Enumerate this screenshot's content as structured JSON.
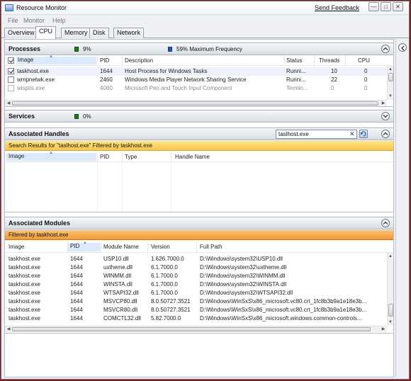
{
  "window": {
    "title": "Resource Monitor",
    "send_feedback": "Send Feedback",
    "controls": [
      "minimize-icon",
      "maximize-icon",
      "close-icon"
    ]
  },
  "menu": {
    "items": [
      "File",
      "Monitor",
      "Help"
    ]
  },
  "tabs": [
    "Overview",
    "CPU",
    "Memory",
    "Disk",
    "Network"
  ],
  "active_tab": "CPU",
  "processes": {
    "title": "Processes",
    "cpu_usage": "9%",
    "max_frequency": "59% Maximum Frequency",
    "columns": [
      "Image",
      "PID",
      "Description",
      "Status",
      "Threads",
      "CPU"
    ],
    "rows": [
      {
        "checked": true,
        "image": "taskhost.exe",
        "pid": "1644",
        "description": "Host Process for Windows Tasks",
        "status": "Runni...",
        "threads": "10",
        "cpu": "0",
        "dim": false
      },
      {
        "checked": false,
        "image": "wmpnetwk.exe",
        "pid": "2460",
        "description": "Windows Media Player Network Sharing Service",
        "status": "Runni...",
        "threads": "22",
        "cpu": "0",
        "dim": false
      },
      {
        "checked": false,
        "image": "wisptis.exe",
        "pid": "4060",
        "description": "Microsoft Pen and Touch Input Component",
        "status": "Termin...",
        "threads": "0",
        "cpu": "0",
        "dim": true
      }
    ]
  },
  "services": {
    "title": "Services",
    "cpu_usage": "0%"
  },
  "handles": {
    "title": "Associated Handles",
    "search_value": "taslhost.exe",
    "banner": "Search Results for \"taslhost.exe\" Filtered by taskhost.exe",
    "columns": [
      "Image",
      "PID",
      "Type",
      "Handle Name"
    ]
  },
  "modules": {
    "title": "Associated Modules",
    "banner": "Filtered by taskhost.exe",
    "columns": [
      "Image",
      "PID",
      "Module Name",
      "Version",
      "Full Path"
    ],
    "rows": [
      {
        "image": "taskhost.exe",
        "pid": "1644",
        "module": "USP10.dll",
        "version": "1.626.7000.0",
        "path": "D:\\Windows\\system32\\USP10.dll"
      },
      {
        "image": "taskhost.exe",
        "pid": "1644",
        "module": "uxtheme.dll",
        "version": "6.1.7000.0",
        "path": "D:\\Windows\\system32\\uxtheme.dll"
      },
      {
        "image": "taskhost.exe",
        "pid": "1644",
        "module": "WINMM.dll",
        "version": "6.1.7000.0",
        "path": "D:\\Windows\\system32\\WINMM.dll"
      },
      {
        "image": "taskhost.exe",
        "pid": "1644",
        "module": "WINSTA.dll",
        "version": "6.1.7000.0",
        "path": "D:\\Windows\\system32\\WINSTA.dll"
      },
      {
        "image": "taskhost.exe",
        "pid": "1644",
        "module": "WTSAPI32.dll",
        "version": "6.1.7000.0",
        "path": "D:\\Windows\\system32\\WTSAPI32.dll"
      },
      {
        "image": "taskhost.exe",
        "pid": "1644",
        "module": "MSVCP80.dll",
        "version": "8.0.50727.3521",
        "path": "D:\\Windows\\WinSxS\\x86_microsoft.vc80.crt_1fc8b3b9a1e18e3b..."
      },
      {
        "image": "taskhost.exe",
        "pid": "1644",
        "module": "MSVCR80.dll",
        "version": "8.0.50727.3521",
        "path": "D:\\Windows\\WinSxS\\x86_microsoft.vc80.crt_1fc8b3b9a1e18e3b..."
      },
      {
        "image": "taskhost.exe",
        "pid": "1644",
        "module": "COMCTL32.dll",
        "version": "5.82.7000.0",
        "path": "D:\\Windows\\WinSxS\\x86_microsoft.windows.common-controls..."
      }
    ]
  },
  "colors": {
    "search_banner": "#f7c648",
    "filter_banner": "#f29a32",
    "cpu_indicator": "#1f7a1f",
    "frequency_indicator": "#2a55b8"
  }
}
